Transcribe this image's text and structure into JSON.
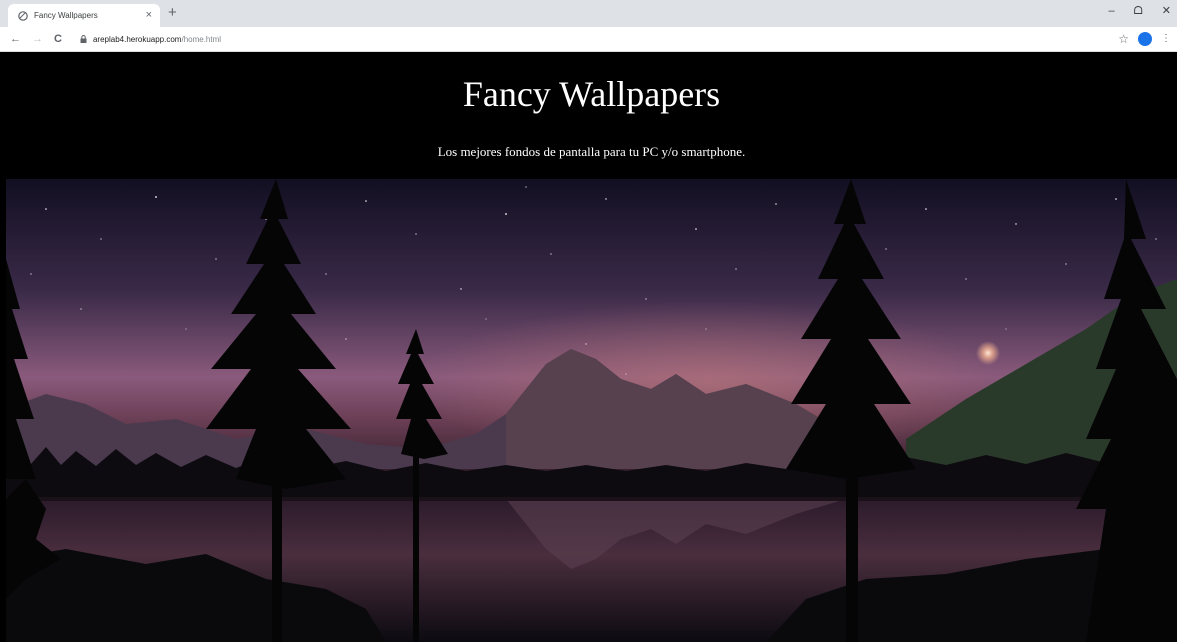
{
  "browser": {
    "tab_title": "Fancy Wallpapers",
    "tab_close": "×",
    "new_tab": "+",
    "url_host": "areplab4.herokuapp.com",
    "url_path": "/home.html",
    "window_controls": {
      "minimize": "–",
      "maximize": "ᗝ",
      "close": "✕"
    }
  },
  "page": {
    "title": "Fancy Wallpapers",
    "subtitle": "Los mejores fondos de pantalla para tu PC y/o smartphone."
  },
  "colors": {
    "header_bg": "#000000",
    "header_text": "#ffffff",
    "sky_top": "#120f22",
    "sky_glow": "#8a5a7c"
  },
  "icons": [
    "globe-icon",
    "close-icon",
    "plus-icon",
    "back-arrow-icon",
    "forward-arrow-icon",
    "reload-icon",
    "lock-icon",
    "star-icon",
    "profile-avatar",
    "kebab-menu-icon"
  ]
}
